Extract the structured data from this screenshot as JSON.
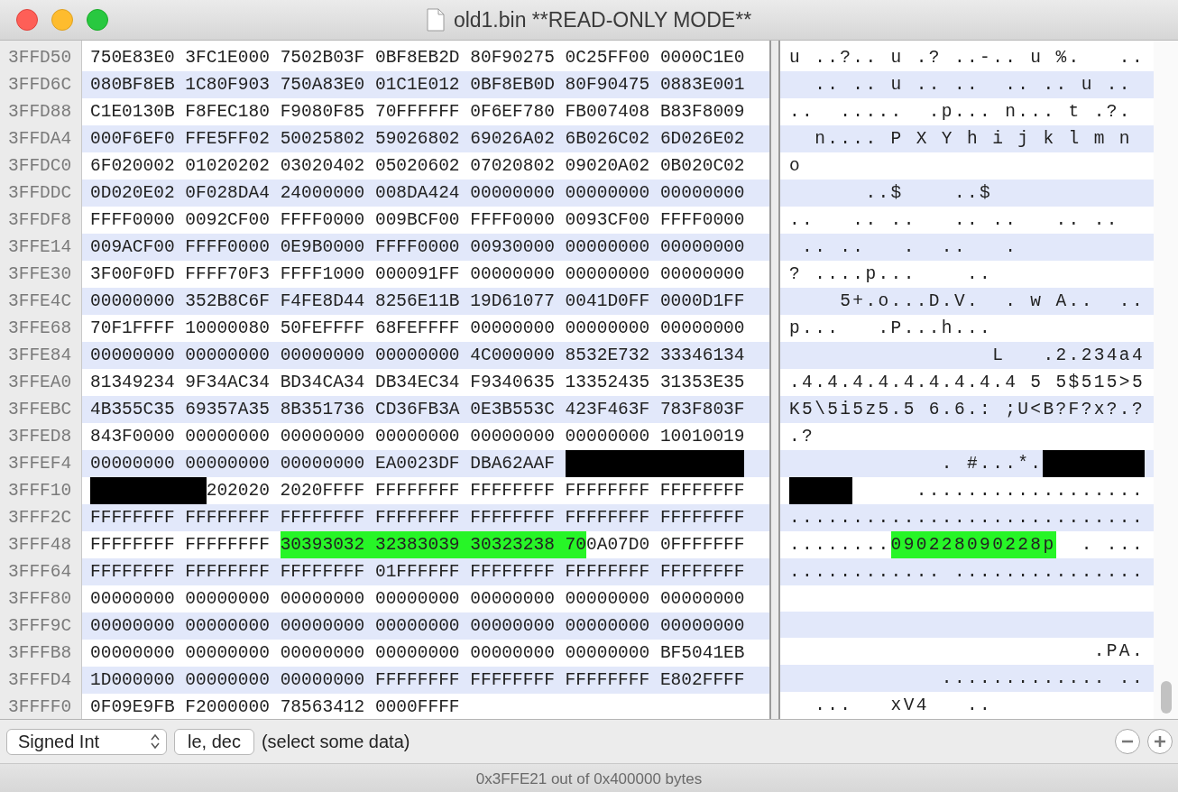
{
  "window": {
    "title": "old1.bin **READ-ONLY MODE**"
  },
  "rows": [
    {
      "offset": "3FFD50",
      "hex": [
        {
          "kind": "plain",
          "text": "750E83E0 3FC1E000 7502B03F 0BF8EB2D 80F90275 0C25FF00 0000C1E0"
        }
      ],
      "ascii": [
        {
          "kind": "plain",
          "text": "u ..?.. u .? ..-.. u %.   .."
        }
      ]
    },
    {
      "offset": "3FFD6C",
      "hex": [
        {
          "kind": "plain",
          "text": "080BF8EB 1C80F903 750A83E0 01C1E012 0BF8EB0D 80F90475 0883E001"
        }
      ],
      "ascii": [
        {
          "kind": "plain",
          "text": "  .. .. u .. ..  .. .. u .."
        }
      ]
    },
    {
      "offset": "3FFD88",
      "hex": [
        {
          "kind": "plain",
          "text": "C1E0130B F8FEC180 F9080F85 70FFFFFF 0F6EF780 FB007408 B83F8009"
        }
      ],
      "ascii": [
        {
          "kind": "plain",
          "text": "..  .....  .p... n... t .?."
        }
      ]
    },
    {
      "offset": "3FFDA4",
      "hex": [
        {
          "kind": "plain",
          "text": "000F6EF0 FFE5FF02 50025802 59026802 69026A02 6B026C02 6D026E02"
        }
      ],
      "ascii": [
        {
          "kind": "plain",
          "text": "  n.... P X Y h i j k l m n"
        }
      ]
    },
    {
      "offset": "3FFDC0",
      "hex": [
        {
          "kind": "plain",
          "text": "6F020002 01020202 03020402 05020602 07020802 09020A02 0B020C02"
        }
      ],
      "ascii": [
        {
          "kind": "plain",
          "text": "o"
        }
      ]
    },
    {
      "offset": "3FFDDC",
      "hex": [
        {
          "kind": "plain",
          "text": "0D020E02 0F028DA4 24000000 008DA424 00000000 00000000 00000000"
        }
      ],
      "ascii": [
        {
          "kind": "plain",
          "text": "      ..$    ..$"
        }
      ]
    },
    {
      "offset": "3FFDF8",
      "hex": [
        {
          "kind": "plain",
          "text": "FFFF0000 0092CF00 FFFF0000 009BCF00 FFFF0000 0093CF00 FFFF0000"
        }
      ],
      "ascii": [
        {
          "kind": "plain",
          "text": "..   .. ..   .. ..   .. .."
        }
      ]
    },
    {
      "offset": "3FFE14",
      "hex": [
        {
          "kind": "plain",
          "text": "009ACF00 FFFF0000 0E9B0000 FFFF0000 00930000 00000000 00000000"
        }
      ],
      "ascii": [
        {
          "kind": "plain",
          "text": " .. ..   .  ..   ."
        }
      ]
    },
    {
      "offset": "3FFE30",
      "hex": [
        {
          "kind": "plain",
          "text": "3F00F0FD FFFF70F3 FFFF1000 000091FF 00000000 00000000 00000000"
        }
      ],
      "ascii": [
        {
          "kind": "plain",
          "text": "? ....p...    .."
        }
      ]
    },
    {
      "offset": "3FFE4C",
      "hex": [
        {
          "kind": "plain",
          "text": "00000000 352B8C6F F4FE8D44 8256E11B 19D61077 0041D0FF 0000D1FF"
        }
      ],
      "ascii": [
        {
          "kind": "plain",
          "text": "    5+.o...D.V.  . w A..  .."
        }
      ]
    },
    {
      "offset": "3FFE68",
      "hex": [
        {
          "kind": "plain",
          "text": "70F1FFFF 10000080 50FEFFFF 68FEFFFF 00000000 00000000 00000000"
        }
      ],
      "ascii": [
        {
          "kind": "plain",
          "text": "p...   .P...h..."
        }
      ]
    },
    {
      "offset": "3FFE84",
      "hex": [
        {
          "kind": "plain",
          "text": "00000000 00000000 00000000 00000000 4C000000 8532E732 33346134"
        }
      ],
      "ascii": [
        {
          "kind": "plain",
          "text": "                L   .2.234a4"
        }
      ]
    },
    {
      "offset": "3FFEA0",
      "hex": [
        {
          "kind": "plain",
          "text": "81349234 9F34AC34 BD34CA34 DB34EC34 F9340635 13352435 31353E35"
        }
      ],
      "ascii": [
        {
          "kind": "plain",
          "text": ".4.4.4.4.4.4.4.4.4 5 5$515>5"
        }
      ]
    },
    {
      "offset": "3FFEBC",
      "hex": [
        {
          "kind": "plain",
          "text": "4B355C35 69357A35 8B351736 CD36FB3A 0E3B553C 423F463F 783F803F"
        }
      ],
      "ascii": [
        {
          "kind": "plain",
          "text": "K5\\5i5z5.5 6.6.: ;U<B?F?x?.?"
        }
      ]
    },
    {
      "offset": "3FFED8",
      "hex": [
        {
          "kind": "plain",
          "text": "843F0000 00000000 00000000 00000000 00000000 00000000 10010019"
        }
      ],
      "ascii": [
        {
          "kind": "plain",
          "text": ".?"
        }
      ]
    },
    {
      "offset": "3FFEF4",
      "hex": [
        {
          "kind": "plain",
          "text": "00000000 00000000 00000000 EA0023DF DBA62AAF "
        },
        {
          "kind": "redacted"
        }
      ],
      "ascii": [
        {
          "kind": "plain",
          "text": "            . #...*."
        },
        {
          "kind": "redacted"
        }
      ]
    },
    {
      "offset": "3FFF10",
      "hex": [
        {
          "kind": "redacted"
        },
        {
          "kind": "plain",
          "text": "202020 2020FFFF FFFFFFFF FFFFFFFF FFFFFFFF FFFFFFFF"
        }
      ],
      "ascii": [
        {
          "kind": "redacted"
        },
        {
          "kind": "plain",
          "text": "     .................."
        }
      ]
    },
    {
      "offset": "3FFF2C",
      "hex": [
        {
          "kind": "plain",
          "text": "FFFFFFFF FFFFFFFF FFFFFFFF FFFFFFFF FFFFFFFF FFFFFFFF FFFFFFFF"
        }
      ],
      "ascii": [
        {
          "kind": "plain",
          "text": "............................"
        }
      ]
    },
    {
      "offset": "3FFF48",
      "hex": [
        {
          "kind": "plain",
          "text": "FFFFFFFF FFFFFFFF "
        },
        {
          "kind": "highlight",
          "text": "30393032 32383039 30323238 70"
        },
        {
          "kind": "plain",
          "text": "0A07D0 0FFFFFFF"
        }
      ],
      "ascii": [
        {
          "kind": "plain",
          "text": "........"
        },
        {
          "kind": "highlight",
          "text": "090228090228p"
        },
        {
          "kind": "plain",
          "text": "  . ..."
        }
      ]
    },
    {
      "offset": "3FFF64",
      "hex": [
        {
          "kind": "plain",
          "text": "FFFFFFFF FFFFFFFF FFFFFFFF 01FFFFFF FFFFFFFF FFFFFFFF FFFFFFFF"
        }
      ],
      "ascii": [
        {
          "kind": "plain",
          "text": "............ ..............."
        }
      ]
    },
    {
      "offset": "3FFF80",
      "hex": [
        {
          "kind": "plain",
          "text": "00000000 00000000 00000000 00000000 00000000 00000000 00000000"
        }
      ]
    },
    {
      "offset": "3FFF9C",
      "hex": [
        {
          "kind": "plain",
          "text": "00000000 00000000 00000000 00000000 00000000 00000000 00000000"
        }
      ]
    },
    {
      "offset": "3FFFB8",
      "hex": [
        {
          "kind": "plain",
          "text": "00000000 00000000 00000000 00000000 00000000 00000000 BF5041EB"
        }
      ],
      "ascii": [
        {
          "kind": "plain",
          "text": "                        .PA."
        }
      ]
    },
    {
      "offset": "3FFFD4",
      "hex": [
        {
          "kind": "plain",
          "text": "1D000000 00000000 00000000 FFFFFFFF FFFFFFFF FFFFFFFF E802FFFF"
        }
      ],
      "ascii": [
        {
          "kind": "plain",
          "text": "            ............. .."
        }
      ]
    },
    {
      "offset": "3FFFF0",
      "hex": [
        {
          "kind": "plain",
          "text": "0F09E9FB F2000000 78563412 0000FFFF"
        }
      ],
      "ascii": [
        {
          "kind": "plain",
          "text": "  ...   xV4   .."
        }
      ]
    }
  ],
  "inspector": {
    "type": "Signed Int",
    "format": "le, dec",
    "value": "(select some data)"
  },
  "status": "0x3FFE21 out of 0x400000 bytes"
}
